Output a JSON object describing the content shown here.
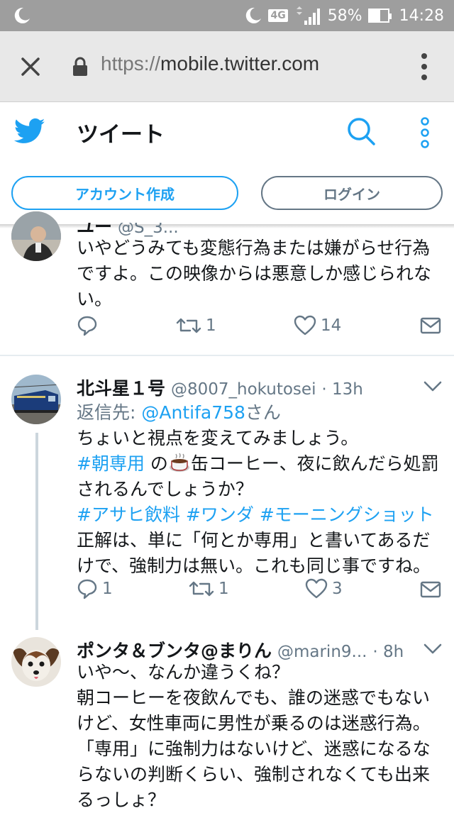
{
  "status": {
    "network": "4G",
    "battery": "58%",
    "time": "14:28"
  },
  "browser": {
    "url_scheme": "https://",
    "url_host": "mobile.twitter.com"
  },
  "header": {
    "title": "ツイート",
    "create_account": "アカウント作成",
    "login": "ログイン"
  },
  "tweet0": {
    "name_partial": "ユー",
    "handle_partial": "@S_3...",
    "lines": [
      "いやどうみても変態行為または嫌がらせ行為",
      "ですよ。この映像からは悪意しか感じられな",
      "い。"
    ],
    "retweets": "1",
    "likes": "14"
  },
  "tweet1": {
    "name": "北斗星１号",
    "handle": "@8007_hokutosei",
    "time": "· 13h",
    "reply_prefix": "返信先: ",
    "reply_to": "@Antifa758",
    "reply_suffix": "さん",
    "line1": "ちょいと視点を変えてみましょう。",
    "tag1": "#朝専用",
    "line2_mid": " の",
    "line2_end": "缶コーヒー、夜に飲んだら処罰",
    "line3": "されるんでしょうか？",
    "tags": [
      "#アサヒ飲料",
      "#ワンダ",
      "#モーニングショット"
    ],
    "line5": "正解は、単に「何とか専用」と書いてあるだ",
    "line6": "けで、強制力は無い。これも同じ事ですね。",
    "replies": "1",
    "retweets": "1",
    "likes": "3"
  },
  "tweet2": {
    "name": "ポンタ＆ブンタ@まりん",
    "handle": "@marin9...",
    "time": "· 8h",
    "lines": [
      "いや〜、なんか違うくね？",
      "朝コーヒーを夜飲んでも、誰の迷惑でもない",
      "けど、女性車両に男性が乗るのは迷惑行為。",
      "「専用」に強制力はないけど、迷惑になるな",
      "らないの判断くらい、強制されなくても出来",
      "るっしょ？"
    ]
  }
}
